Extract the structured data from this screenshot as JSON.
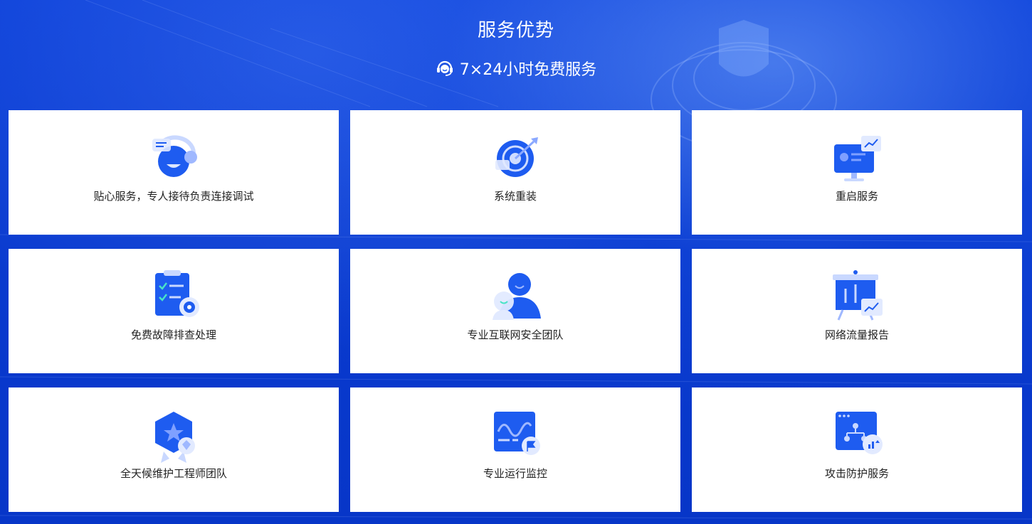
{
  "header": {
    "title": "服务优势",
    "subtitle": "7×24小时免费服务",
    "subtitle_icon": "customer-service-icon"
  },
  "colors": {
    "background": "#0a3fd6",
    "card": "#ffffff",
    "icon_blue": "#1e5cf0",
    "text": "#222222"
  },
  "services": [
    {
      "label": "贴心服务，专人接待负责连接调试",
      "icon": "service-agent-icon"
    },
    {
      "label": "系统重装",
      "icon": "target-icon"
    },
    {
      "label": "重启服务",
      "icon": "monitor-icon"
    },
    {
      "label": "免费故障排查处理",
      "icon": "clipboard-check-icon"
    },
    {
      "label": "专业互联网安全团队",
      "icon": "security-team-icon"
    },
    {
      "label": "网络流量报告",
      "icon": "presentation-chart-icon"
    },
    {
      "label": "全天候维护工程师团队",
      "icon": "badge-star-icon"
    },
    {
      "label": "专业运行监控",
      "icon": "monitoring-screen-icon"
    },
    {
      "label": "攻击防护服务",
      "icon": "network-protection-icon"
    }
  ]
}
